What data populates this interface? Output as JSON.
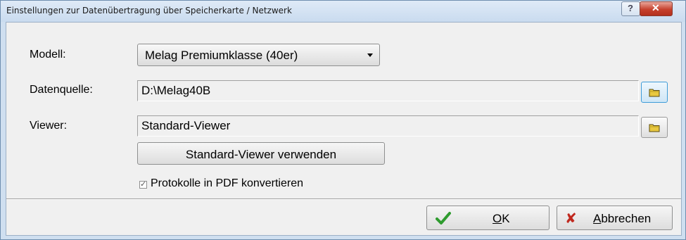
{
  "window": {
    "title": "Einstellungen zur Datenübertragung über Speicherkarte / Netzwerk",
    "help_label": "?",
    "close_label": "✕"
  },
  "form": {
    "model_label": "Modell:",
    "model_value": "Melag Premiumklasse (40er)",
    "source_label": "Datenquelle:",
    "source_value": "D:\\Melag40B",
    "viewer_label": "Viewer:",
    "viewer_value": "Standard-Viewer",
    "use_standard_viewer_label": "Standard-Viewer verwenden",
    "convert_pdf_label": "Protokolle in PDF konvertieren",
    "convert_pdf_checked": true
  },
  "footer": {
    "ok_accel": "O",
    "ok_rest": "K",
    "cancel_accel": "A",
    "cancel_rest": "bbrechen"
  },
  "icons": {
    "folder": "folder-icon",
    "ok": "checkmark-icon",
    "cancel": "red-x-icon",
    "checkbox": "checkbox-checked-icon"
  },
  "colors": {
    "title_bar": "#c9dbef",
    "close_button": "#c6412d",
    "ok_check": "#2e9b2e",
    "cancel_x": "#c0281e",
    "folder": "#e8c840"
  }
}
